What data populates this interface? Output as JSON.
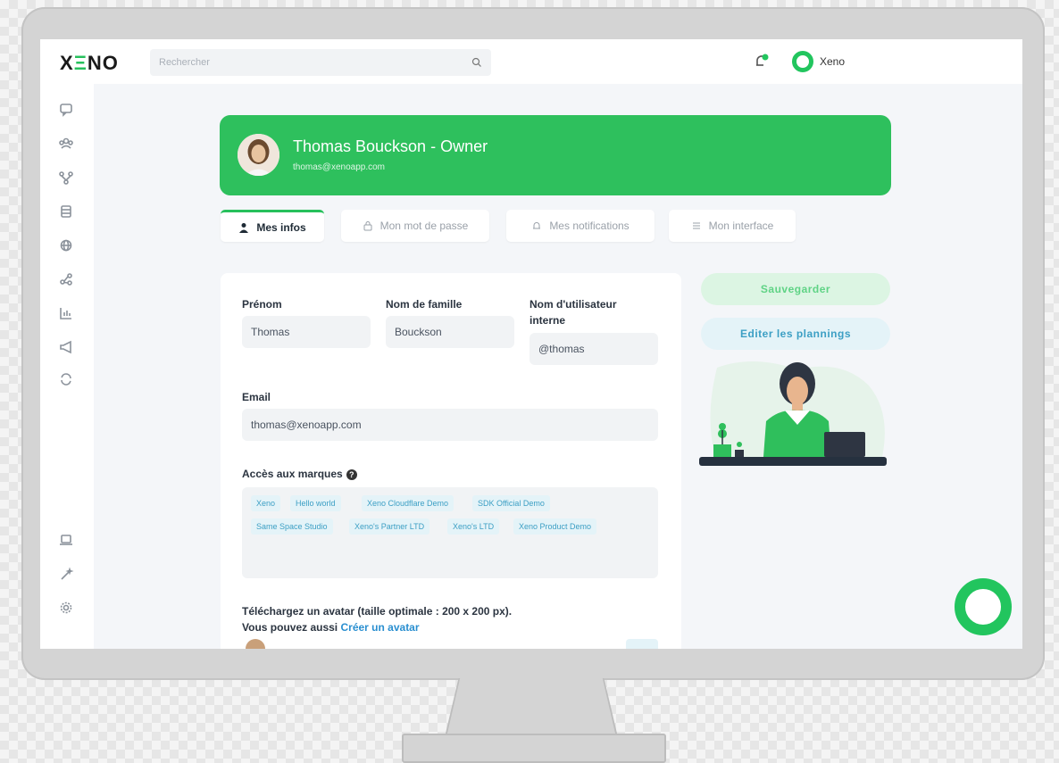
{
  "app": {
    "logo": "XENO"
  },
  "search": {
    "placeholder": "Rechercher"
  },
  "account": {
    "name": "Xeno"
  },
  "profile": {
    "name": "Thomas Bouckson - Owner",
    "email": "thomas@xenoapp.com"
  },
  "tabs": [
    {
      "label": "Mes infos",
      "icon": "user-icon",
      "active": true
    },
    {
      "label": "Mon mot de passe",
      "icon": "lock-icon",
      "active": false
    },
    {
      "label": "Mes notifications",
      "icon": "bell-icon",
      "active": false
    },
    {
      "label": "Mon interface",
      "icon": "list-icon",
      "active": false
    }
  ],
  "form": {
    "first_name_label": "Prénom",
    "first_name_value": "Thomas",
    "last_name_label": "Nom de famille",
    "last_name_value": "Bouckson",
    "username_label_line1": "Nom d'utilisateur",
    "username_label_line2": "interne",
    "username_value": "@thomas",
    "email_label": "Email",
    "email_value": "thomas@xenoapp.com",
    "brands_label": "Accès aux marques",
    "brands": [
      "Xeno",
      "Hello world",
      "Xeno Cloudflare Demo",
      "SDK Official Demo",
      "Same Space Studio",
      "Xeno's Partner LTD",
      "Xeno's LTD",
      "Xeno Product Demo"
    ],
    "upload_line1": "Téléchargez un avatar (taille optimale : 200 x 200 px).",
    "upload_line2_prefix": "Vous pouvez aussi",
    "upload_link": "Créer un avatar"
  },
  "actions": {
    "save": "Sauvegarder",
    "edit_plannings": "Editer les plannings"
  },
  "sidebar_icons": [
    "chat-icon",
    "users-icon",
    "flow-icon",
    "database-icon",
    "globe-icon",
    "share-icon",
    "chart-icon",
    "megaphone-icon",
    "refresh-icon",
    "laptop-icon",
    "magic-wand-icon",
    "settings-icon"
  ],
  "colors": {
    "brand_green": "#2ec05d",
    "link_blue": "#2a8fd0",
    "chip_blue": "#3c9fc4"
  }
}
